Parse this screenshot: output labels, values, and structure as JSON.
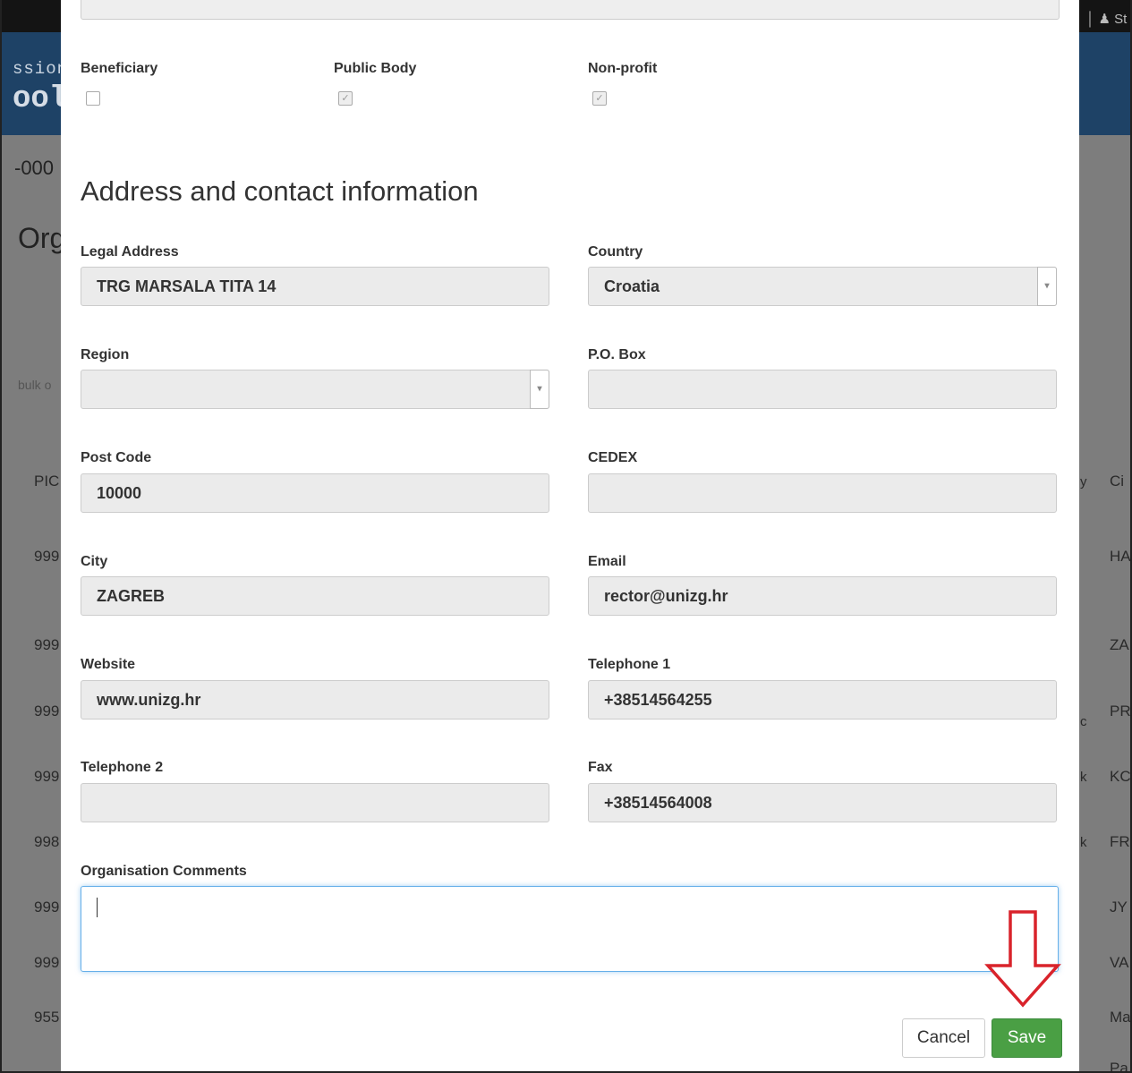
{
  "background": {
    "logo_line1": "ssion",
    "logo_line2": "ool",
    "code": "-000",
    "org_fragment": "Org",
    "bulk_fragment": "bulk o",
    "user_fragment": "│ ♟ St",
    "left_column": [
      "PIC",
      "999",
      "999",
      "999",
      "999",
      "998",
      "999",
      "999",
      "955"
    ],
    "right_column": [
      "Ci",
      "HA",
      "ZA",
      "PR",
      "KC",
      "FR",
      "JY",
      "VA",
      "Ma",
      "Pa"
    ],
    "mid_column": [
      "y",
      "c",
      "k",
      "k"
    ]
  },
  "checkboxes": [
    {
      "label": "Beneficiary",
      "checked": false
    },
    {
      "label": "Public Body",
      "checked": true
    },
    {
      "label": "Non-profit",
      "checked": true
    }
  ],
  "section_title": "Address and contact information",
  "fields": {
    "legal_address": {
      "label": "Legal Address",
      "value": "TRG MARSALA TITA 14"
    },
    "country": {
      "label": "Country",
      "value": "Croatia"
    },
    "region": {
      "label": "Region",
      "value": ""
    },
    "po_box": {
      "label": "P.O. Box",
      "value": ""
    },
    "post_code": {
      "label": "Post Code",
      "value": "10000"
    },
    "cedex": {
      "label": "CEDEX",
      "value": ""
    },
    "city": {
      "label": "City",
      "value": "ZAGREB"
    },
    "email": {
      "label": "Email",
      "value": "rector@unizg.hr"
    },
    "website": {
      "label": "Website",
      "value": "www.unizg.hr"
    },
    "telephone1": {
      "label": "Telephone 1",
      "value": "+38514564255"
    },
    "telephone2": {
      "label": "Telephone 2",
      "value": ""
    },
    "fax": {
      "label": "Fax",
      "value": "+38514564008"
    },
    "comments": {
      "label": "Organisation Comments",
      "value": ""
    }
  },
  "buttons": {
    "cancel": "Cancel",
    "save": "Save"
  },
  "colors": {
    "save": "#4a9f44",
    "arrow": "#d9232b",
    "focus": "#66afe9",
    "header_blue": "#1e4266"
  }
}
